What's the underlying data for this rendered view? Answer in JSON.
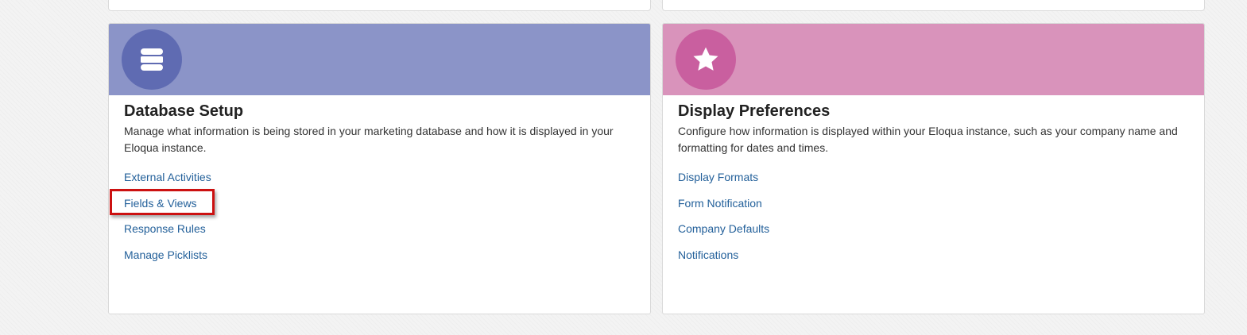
{
  "colors": {
    "database_header": "#8b94c8",
    "database_icon_bg": "#5f6bb2",
    "display_header": "#d993bb",
    "display_icon_bg": "#c95f9f",
    "link": "#23609a",
    "highlight": "#cc1111"
  },
  "cards": [
    {
      "icon": "database-icon",
      "title": "Database Setup",
      "description": "Manage what information is being stored in your marketing database and how it is displayed in your Eloqua instance.",
      "links": [
        "External Activities",
        "Fields & Views",
        "Response Rules",
        "Manage Picklists"
      ],
      "highlighted_link": "Fields & Views"
    },
    {
      "icon": "star-icon",
      "title": "Display Preferences",
      "description": "Configure how information is displayed within your Eloqua instance, such as your company name and formatting for dates and times.",
      "links": [
        "Display Formats",
        "Form Notification",
        "Company Defaults",
        "Notifications"
      ]
    }
  ]
}
